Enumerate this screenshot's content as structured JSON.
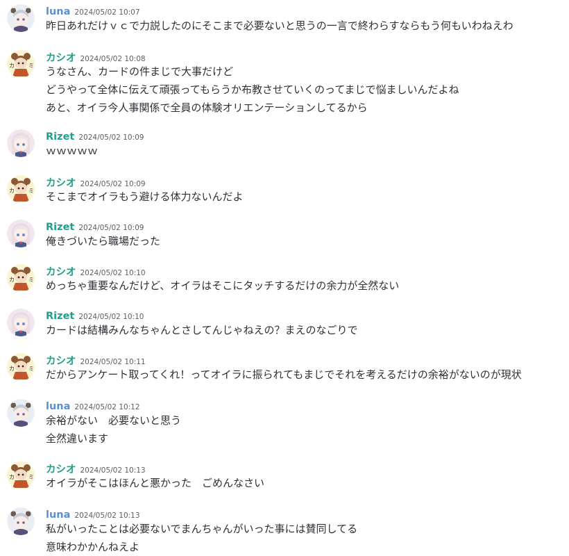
{
  "users": {
    "luna": {
      "name": "luna",
      "color": "#5a8fd6",
      "avatar_icon": "luna-avatar-icon"
    },
    "kashio": {
      "name": "カシオ",
      "color": "#1fa08a",
      "avatar_icon": "kashio-avatar-icon"
    },
    "rizet": {
      "name": "Rizet",
      "color": "#1fa08a",
      "avatar_icon": "rizet-avatar-icon"
    }
  },
  "messages": [
    {
      "user": "luna",
      "time": "2024/05/02 10:07",
      "lines": [
        "昨日あれだけｖｃで力説したのにそこまで必要ないと思うの一言で終わらすならもう何もいわねえわ"
      ]
    },
    {
      "user": "kashio",
      "time": "2024/05/02 10:08",
      "lines": [
        "うなさん、カードの件まじで大事だけど",
        "どうやって全体に伝えて頑張ってもらうか布教させていくのってまじで悩ましいんだよね",
        "あと、オイラ今人事関係で全員の体験オリエンテーションしてるから"
      ]
    },
    {
      "user": "rizet",
      "time": "2024/05/02 10:09",
      "lines": [
        "ｗｗｗｗｗ"
      ]
    },
    {
      "user": "kashio",
      "time": "2024/05/02 10:09",
      "lines": [
        "そこまでオイラもう避ける体力ないんだよ"
      ]
    },
    {
      "user": "rizet",
      "time": "2024/05/02 10:09",
      "lines": [
        "俺きづいたら職場だった"
      ]
    },
    {
      "user": "kashio",
      "time": "2024/05/02 10:10",
      "lines": [
        "めっちゃ重要なんだけど、オイラはそこにタッチするだけの余力が全然ない"
      ]
    },
    {
      "user": "rizet",
      "time": "2024/05/02 10:10",
      "lines": [
        "カードは結構みんなちゃんとさしてんじゃねえの？まえのなごりで"
      ]
    },
    {
      "user": "kashio",
      "time": "2024/05/02 10:11",
      "lines": [
        "だからアンケート取ってくれ！ってオイラに振られてもまじでそれを考えるだけの余裕がないのが現状"
      ]
    },
    {
      "user": "luna",
      "time": "2024/05/02 10:12",
      "lines": [
        "余裕がない　必要ないと思う",
        "全然違います"
      ]
    },
    {
      "user": "kashio",
      "time": "2024/05/02 10:13",
      "lines": [
        "オイラがそこはほんと悪かった　ごめんなさい"
      ]
    },
    {
      "user": "luna",
      "time": "2024/05/02 10:13",
      "lines": [
        "私がいったことは必要ないでまんちゃんがいった事には賛同してる",
        "意味わかかんねえよ"
      ]
    }
  ]
}
